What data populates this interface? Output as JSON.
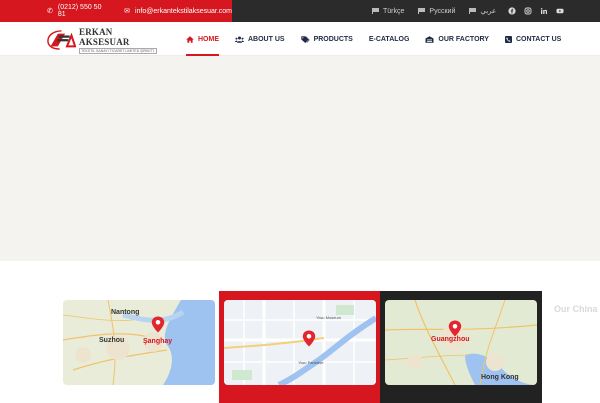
{
  "topbar": {
    "phone": "(0212) 550 50 81",
    "email": "info@erkantekstilaksesuar.com",
    "languages": [
      "Türkçe",
      "Русский",
      "عربي"
    ],
    "socials": [
      "facebook-icon",
      "instagram-icon",
      "linkedin-icon",
      "youtube-icon"
    ],
    "accent": "#d6171f"
  },
  "header": {
    "logo_name": "ERKAN AKSESUAR",
    "logo_sub": "TEKSTİL SANAYİ TİCARET LİMİTED ŞİRKETİ",
    "nav": [
      {
        "label": "HOME",
        "icon": "home-icon",
        "active": true
      },
      {
        "label": "ABOUT US",
        "icon": "users-icon",
        "active": false
      },
      {
        "label": "PRODUCTS",
        "icon": "tags-icon",
        "active": false
      },
      {
        "label": "E-CATALOG",
        "icon": "",
        "active": false
      },
      {
        "label": "OUR FACTORY",
        "icon": "factory-icon",
        "active": false
      },
      {
        "label": "CONTACT US",
        "icon": "phone-square-icon",
        "active": false
      }
    ]
  },
  "maps": {
    "section_title": "Our China",
    "cards": [
      {
        "labels": [
          "Nantong",
          "Suzhou",
          "Şanghay"
        ]
      },
      {
        "labels": [
          "Yiwu Museum",
          "Yiwu Paradise"
        ]
      },
      {
        "labels": [
          "Guangzhou",
          "Hong Kong"
        ]
      }
    ]
  }
}
